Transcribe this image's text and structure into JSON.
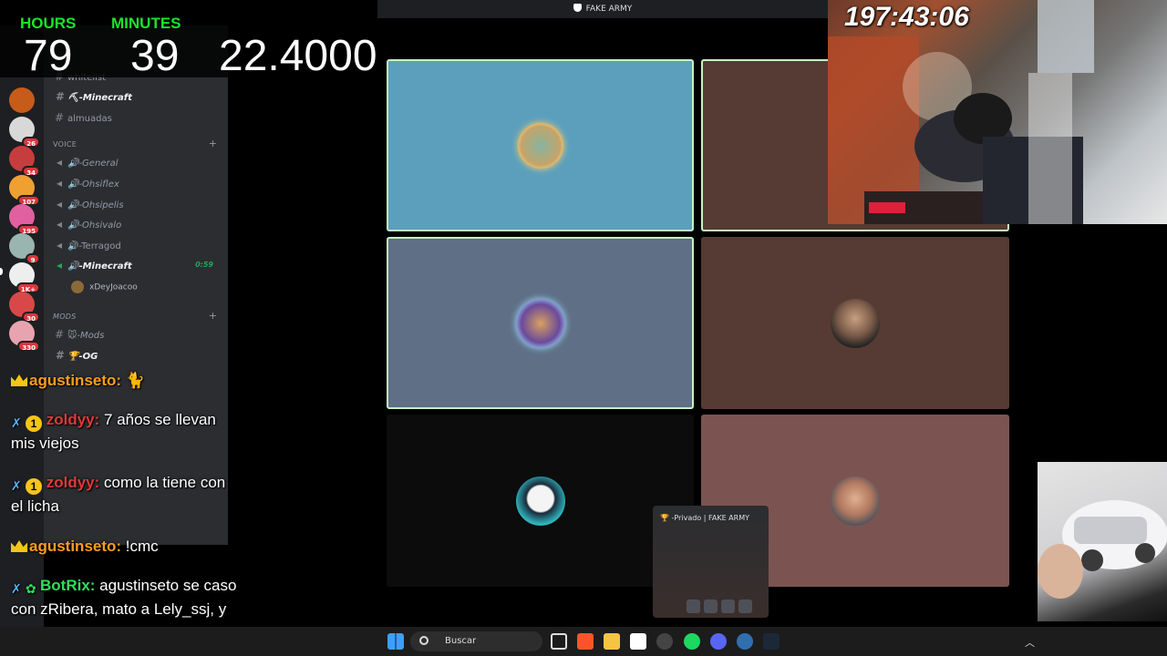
{
  "overlay": {
    "hours_label": "HOURS",
    "minutes_label": "MINUTES",
    "hours_value": "79",
    "minutes_value": "39",
    "seconds_value": "22.4000",
    "countdown": "197:43:06"
  },
  "call": {
    "title": "FAKE ARMY"
  },
  "channels": {
    "server_header": "FAKE ARMY",
    "items": [
      {
        "label": "whitelist"
      },
      {
        "label": "⛏-Minecraft"
      },
      {
        "label": "almuadas"
      }
    ],
    "voice_category": "VOICE",
    "voice_channels": [
      {
        "label": "🔊-General"
      },
      {
        "label": "🔊-Ohsiflex"
      },
      {
        "label": "🔊-Ohsipelis"
      },
      {
        "label": "🔊-Ohsivalo"
      },
      {
        "label": "🔊-Terragod"
      },
      {
        "label": "🔊-Minecraft",
        "time": "0:59"
      }
    ],
    "voice_user": "xDeyJoacoo",
    "mods_category": "MODS",
    "mods_channels": [
      {
        "label": "🐭-Mods"
      },
      {
        "label": "🏆-OG"
      }
    ]
  },
  "server_badges": [
    "26",
    "34",
    "107",
    "195",
    "9",
    "1K+",
    "30",
    "330"
  ],
  "chat": [
    {
      "user": "agustinseto:",
      "text": " 🐈"
    },
    {
      "user": "zoldyy:",
      "text": " 7 años se llevan mis viejos"
    },
    {
      "user": "zoldyy:",
      "text": " como la tiene con el licha"
    },
    {
      "user": "agustinseto:",
      "text": " !cmc"
    },
    {
      "user": "BotRix:",
      "text": " agustinseto se caso con zRibera, mato a Lely_ssj, y se garcho a Tojsillo"
    }
  ],
  "mini_popup": {
    "title": "🏆 -Privado | FAKE ARMY"
  },
  "taskbar": {
    "search_label": "Buscar"
  },
  "colors": {
    "timer_green": "#19e62b",
    "discord_bg": "#2b2d31",
    "speaking_border": "#c7f0c0",
    "tile_blue": "#5b9fbd",
    "tile_slate": "#5e6f86",
    "tile_brown": "#553b33",
    "tile_rose": "#7b5452"
  }
}
